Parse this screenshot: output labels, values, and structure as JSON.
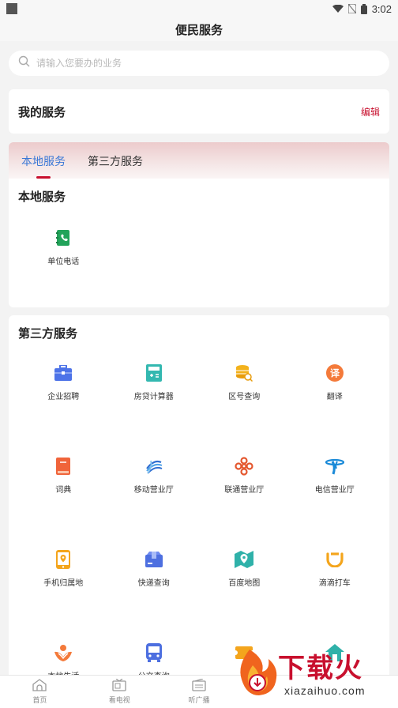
{
  "status": {
    "time": "3:02"
  },
  "header": {
    "title": "便民服务"
  },
  "search": {
    "placeholder": "请输入您要办的业务"
  },
  "my_services": {
    "title": "我的服务",
    "edit_label": "编辑"
  },
  "tabs": [
    {
      "label": "本地服务",
      "active": true
    },
    {
      "label": "第三方服务",
      "active": false
    }
  ],
  "local_section": {
    "title": "本地服务",
    "items": [
      {
        "label": "单位电话",
        "icon": "phone-book-icon",
        "color": "#22a35a"
      }
    ]
  },
  "third_section": {
    "title": "第三方服务",
    "items": [
      {
        "label": "企业招聘",
        "icon": "briefcase-icon",
        "color": "#4d73e8"
      },
      {
        "label": "房贷计算器",
        "icon": "calculator-icon",
        "color": "#33b8b0"
      },
      {
        "label": "区号查询",
        "icon": "coins-search-icon",
        "color": "#f3b21c"
      },
      {
        "label": "翻译",
        "icon": "translate-icon",
        "color": "#f47a3a"
      },
      {
        "label": "词典",
        "icon": "dictionary-icon",
        "color": "#f0643a"
      },
      {
        "label": "移动营业厅",
        "icon": "china-mobile-icon",
        "color": "#2f6ed1"
      },
      {
        "label": "联通营业厅",
        "icon": "china-unicom-icon",
        "color": "#e4572e"
      },
      {
        "label": "电信营业厅",
        "icon": "china-telecom-icon",
        "color": "#1a8ad8"
      },
      {
        "label": "手机归属地",
        "icon": "phone-location-icon",
        "color": "#f4a51c"
      },
      {
        "label": "快递查询",
        "icon": "parcel-icon",
        "color": "#4d6fe0"
      },
      {
        "label": "百度地图",
        "icon": "map-icon",
        "color": "#2fb1a9"
      },
      {
        "label": "滴滴打车",
        "icon": "didi-icon",
        "color": "#f4a51c"
      },
      {
        "label": "本地生活",
        "icon": "local-life-icon",
        "color": "#f47a3a"
      },
      {
        "label": "公交查询",
        "icon": "bus-icon",
        "color": "#4d6fe0"
      },
      {
        "label": "",
        "icon": "ticket-icon",
        "color": "#f4a51c"
      },
      {
        "label": "",
        "icon": "house-icon",
        "color": "#2fb1a9"
      }
    ]
  },
  "bottom_nav": [
    {
      "label": "首页",
      "icon": "home-icon"
    },
    {
      "label": "看电视",
      "icon": "tv-icon"
    },
    {
      "label": "听广播",
      "icon": "radio-icon"
    },
    {
      "label": "",
      "icon": "blank-icon"
    },
    {
      "label": "",
      "icon": "blank-icon"
    }
  ],
  "watermark": {
    "brand": "下载火",
    "site": "xiazaihuo.com"
  }
}
